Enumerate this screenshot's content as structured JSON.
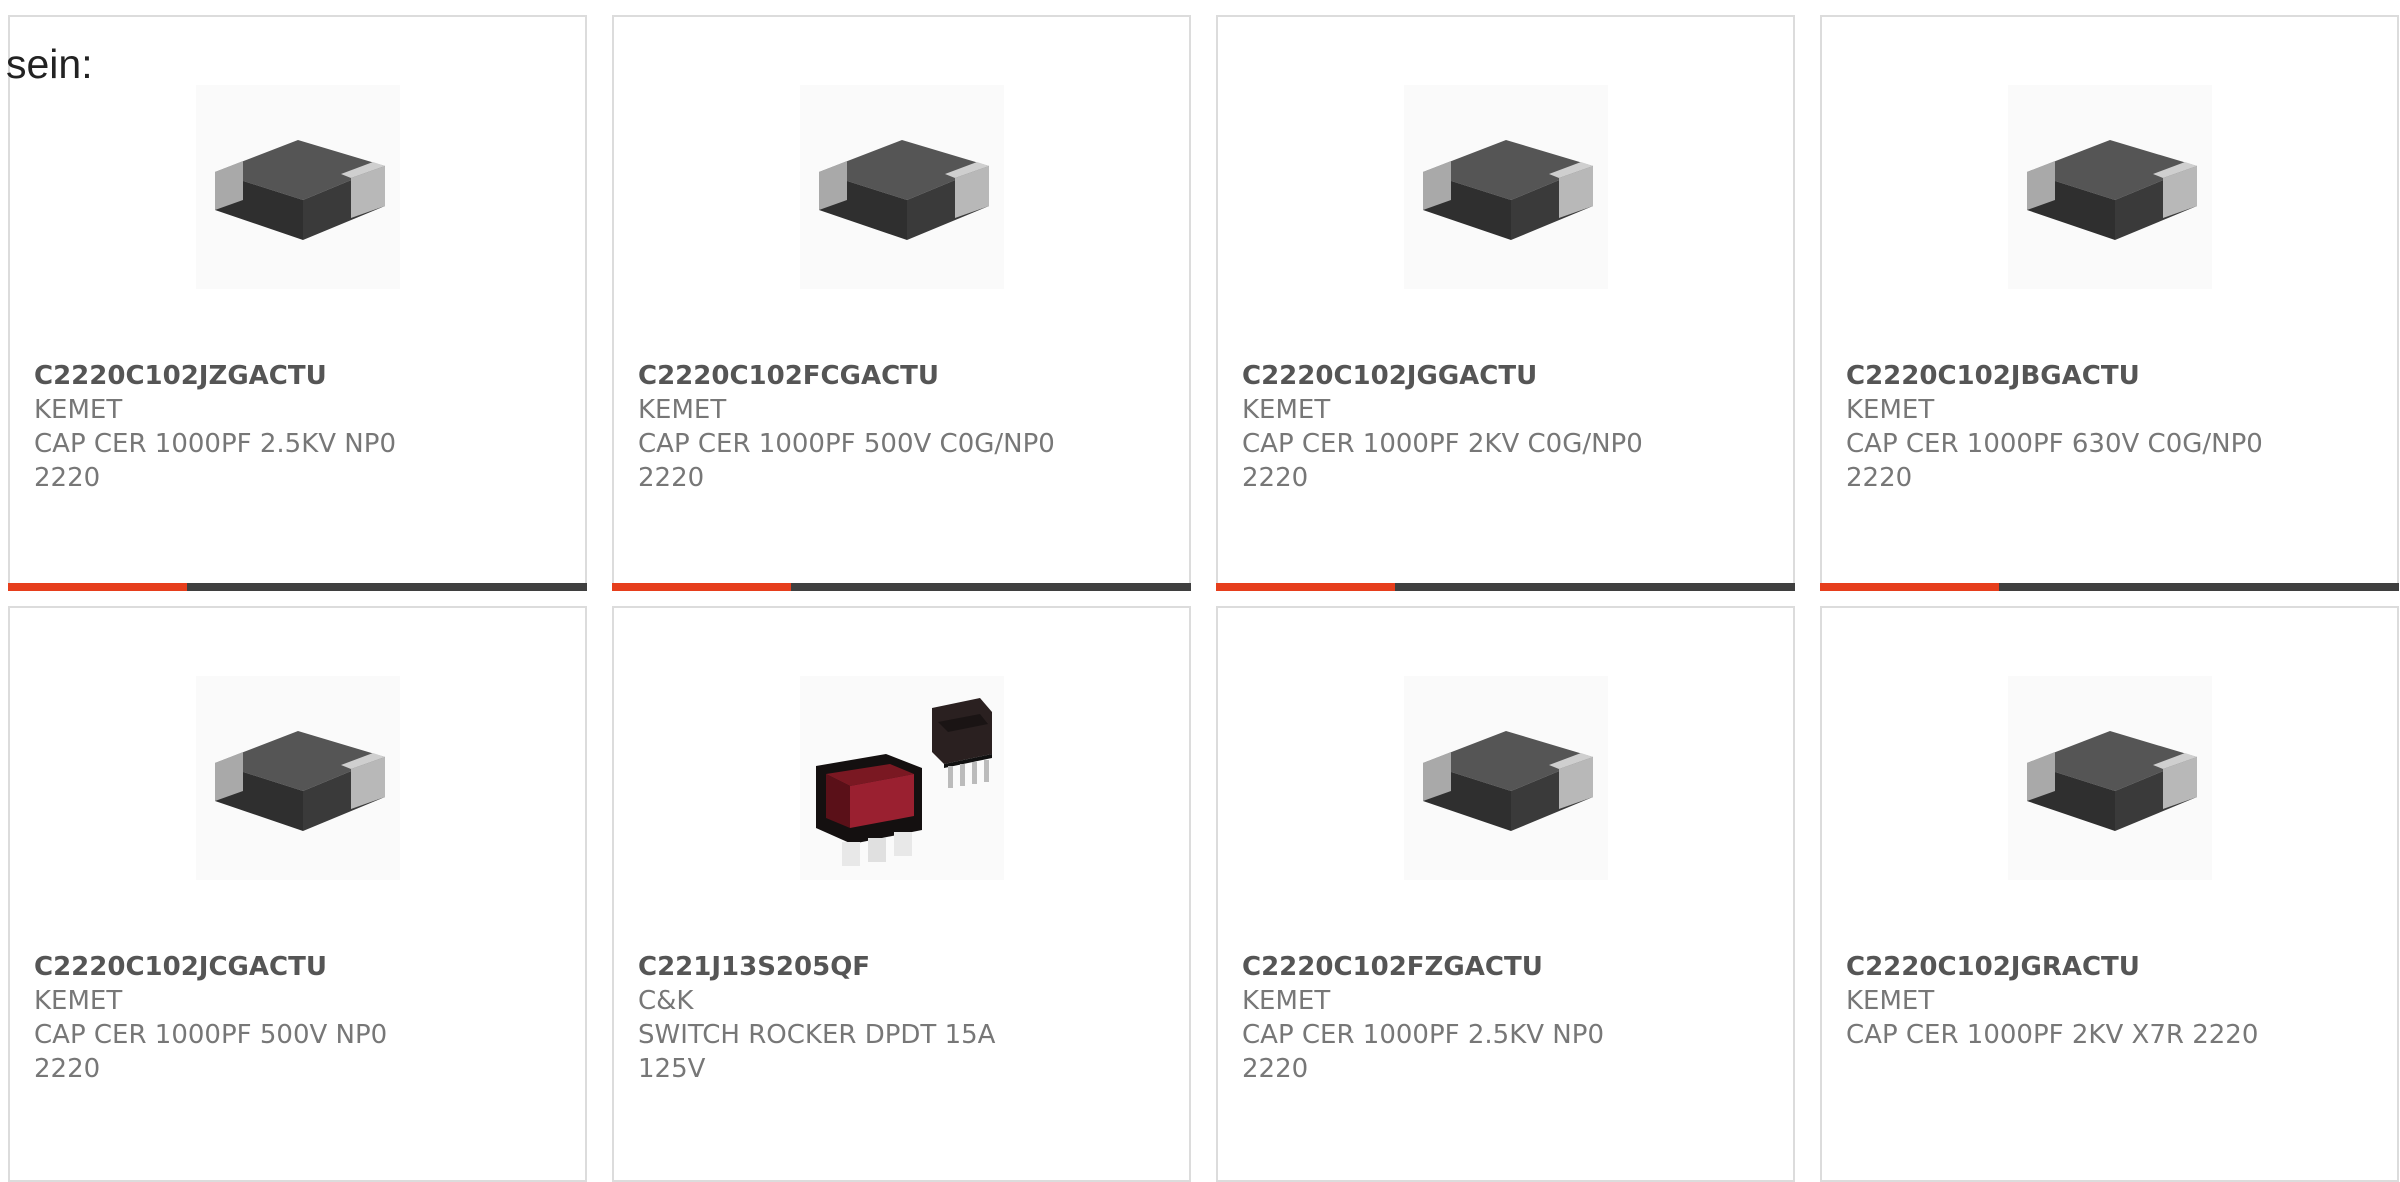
{
  "intro_text": "sein:",
  "colors": {
    "accent": "#e63e1c",
    "bar": "#3f3f3f",
    "border": "#dcdcdc"
  },
  "products": [
    {
      "part": "C2220C102JZGACTU",
      "maker": "KEMET",
      "desc": "CAP CER 1000PF 2.5KV NP0 2220",
      "image_icon": "ceramic-capacitor-icon",
      "progress": 0.31
    },
    {
      "part": "C2220C102FCGACTU",
      "maker": "KEMET",
      "desc": "CAP CER 1000PF 500V C0G/NP0 2220",
      "image_icon": "ceramic-capacitor-icon",
      "progress": 0.31
    },
    {
      "part": "C2220C102JGGACTU",
      "maker": "KEMET",
      "desc": "CAP CER 1000PF 2KV C0G/NP0 2220",
      "image_icon": "ceramic-capacitor-icon",
      "progress": 0.31
    },
    {
      "part": "C2220C102JBGACTU",
      "maker": "KEMET",
      "desc": "CAP CER 1000PF 630V C0G/NP0 2220",
      "image_icon": "ceramic-capacitor-icon",
      "progress": 0.31
    },
    {
      "part": "C2220C102JCGACTU",
      "maker": "KEMET",
      "desc": "CAP CER 1000PF 500V NP0 2220",
      "image_icon": "ceramic-capacitor-icon"
    },
    {
      "part": "C221J13S205QF",
      "maker": "C&K",
      "desc": "SWITCH ROCKER DPDT 15A 125V",
      "image_icon": "rocker-switch-icon"
    },
    {
      "part": "C2220C102FZGACTU",
      "maker": "KEMET",
      "desc": "CAP CER 1000PF 2.5KV NP0 2220",
      "image_icon": "ceramic-capacitor-icon"
    },
    {
      "part": "C2220C102JGRACTU",
      "maker": "KEMET",
      "desc": "CAP CER 1000PF 2KV X7R 2220",
      "image_icon": "ceramic-capacitor-icon"
    }
  ]
}
